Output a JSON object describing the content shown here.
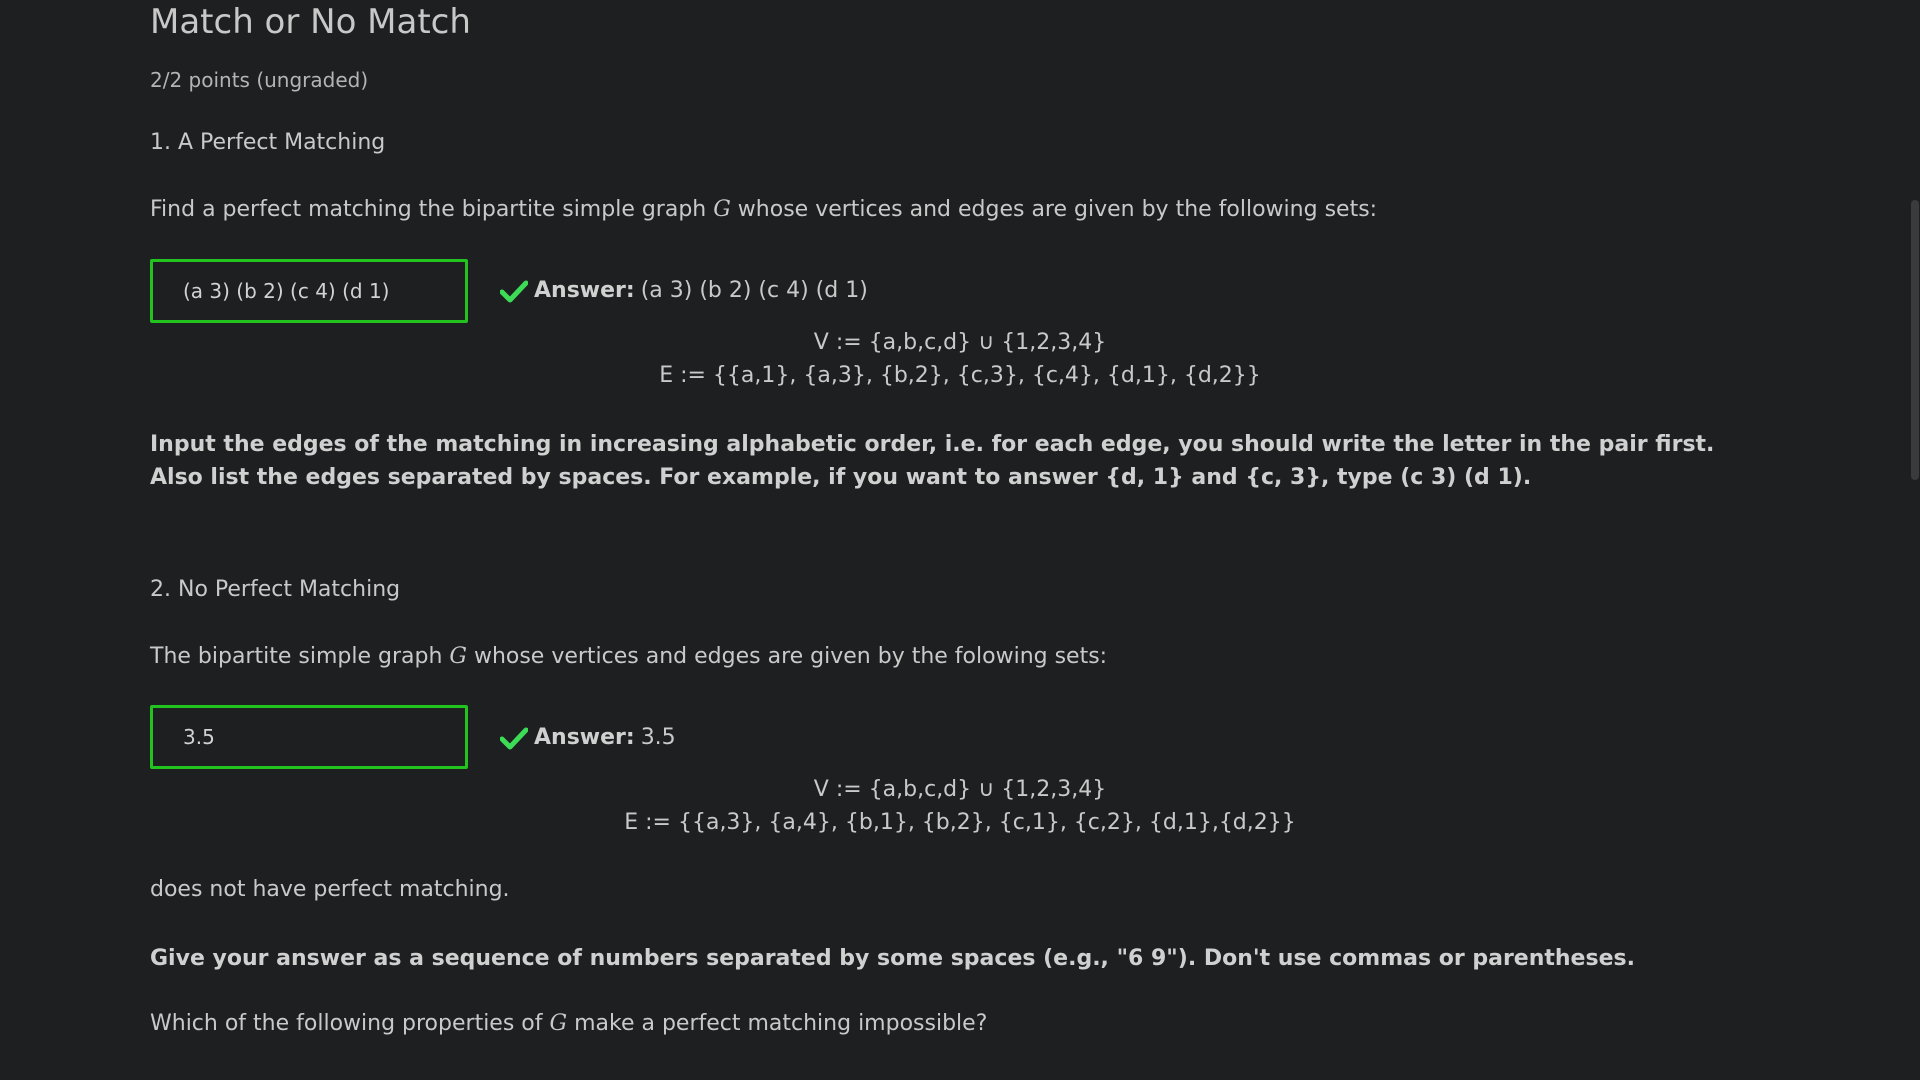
{
  "problem": {
    "title": "Match or No Match",
    "points": "2/2 points (ungraded)"
  },
  "part1": {
    "heading": "1. A Perfect Matching",
    "prompt_before": "Find a perfect matching the bipartite simple graph ",
    "graph_symbol": "G",
    "prompt_after": " whose vertices and edges are given by the following sets:",
    "input_value": "(a 3) (b 2) (c 4) (d 1)",
    "answer_label": "Answer:",
    "answer_value": "(a 3) (b 2) (c 4) (d 1)",
    "vertices": "V := {a,b,c,d} ∪ {1,2,3,4}",
    "edges": "E := {{a,1}, {a,3}, {b,2}, {c,3}, {c,4}, {d,1}, {d,2}}",
    "instructions": "Input the edges of the matching in increasing alphabetic order, i.e. for each edge, you should write the letter in the pair first. Also list the edges separated by spaces. For example, if you want to answer {d, 1} and {c, 3}, type (c 3) (d 1)."
  },
  "part2": {
    "heading": "2. No Perfect Matching",
    "prompt_before": "The bipartite simple graph ",
    "graph_symbol": "G",
    "prompt_after": " whose vertices and edges are given by the folowing sets:",
    "input_value": "3.5",
    "answer_label": "Answer:",
    "answer_value": "3.5",
    "vertices": "V := {a,b,c,d} ∪ {1,2,3,4}",
    "edges": "E := {{a,3}, {a,4}, {b,1}, {b,2}, {c,1}, {c,2}, {d,1},{d,2}}",
    "no_matching_text": "does not have perfect matching.",
    "instructions": "Give your answer as a sequence of numbers separated by some spaces (e.g., \"6 9\"). Don't use commas or parentheses.",
    "question_before": "Which of the following properties of ",
    "question_symbol": "G",
    "question_after": " make a perfect matching impossible?"
  },
  "colors": {
    "background": "#1e1f20",
    "text": "#c9c9c9",
    "correct_green": "#22c21f",
    "check_green": "#3ddc57"
  },
  "icons": {
    "correct": "checkmark-icon"
  }
}
